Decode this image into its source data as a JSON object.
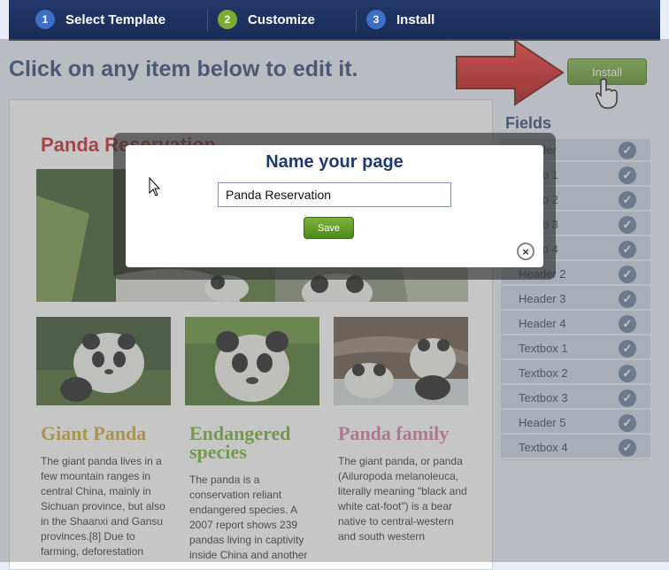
{
  "steps": [
    {
      "num": "1",
      "label": "Select Template",
      "color": "#3d6fc4"
    },
    {
      "num": "2",
      "label": "Customize",
      "color": "#7cab34"
    },
    {
      "num": "3",
      "label": "Install",
      "color": "#3d6fc4"
    }
  ],
  "headline": "Click on any item below to edit it.",
  "install_label": "Install",
  "canvas": {
    "page_title": "Panda Reservation",
    "columns": [
      {
        "title": "Giant Panda",
        "color": "#c9a227",
        "text": "The giant panda lives in a few mountain ranges in central China, mainly in Sichuan province, but also in the Shaanxi and Gansu provinces.[8] Due to farming, deforestation"
      },
      {
        "title": "Endangered species",
        "color": "#6aaa2a",
        "text": "The panda is a conservation reliant endangered species. A 2007 report shows 239 pandas living in captivity inside China and another"
      },
      {
        "title": "Panda family",
        "color": "#d2729c",
        "text": "The giant panda, or panda (Ailuropoda melanoleuca, literally meaning \"black and white cat-foot\") is a bear native to central-western and south western"
      }
    ]
  },
  "fields": {
    "title": "Fields",
    "items": [
      "Header",
      "Photo 1",
      "Photo 2",
      "Photo 3",
      "Photo 4",
      "Header 2",
      "Header 3",
      "Header 4",
      "Textbox 1",
      "Textbox 2",
      "Textbox 3",
      "Header 5",
      "Textbox 4"
    ]
  },
  "modal": {
    "title": "Name your page",
    "input_value": "Panda Reservation",
    "save_label": "Save",
    "close_glyph": "×"
  },
  "icons": {
    "check": "check-icon",
    "close": "close-icon",
    "arrow": "red-arrow-icon",
    "hand": "hand-cursor-icon",
    "pointer": "pointer-cursor-icon"
  },
  "colors": {
    "accent": "#1f3a6e",
    "green": "#5c9a24",
    "title_red": "#c0141b"
  }
}
